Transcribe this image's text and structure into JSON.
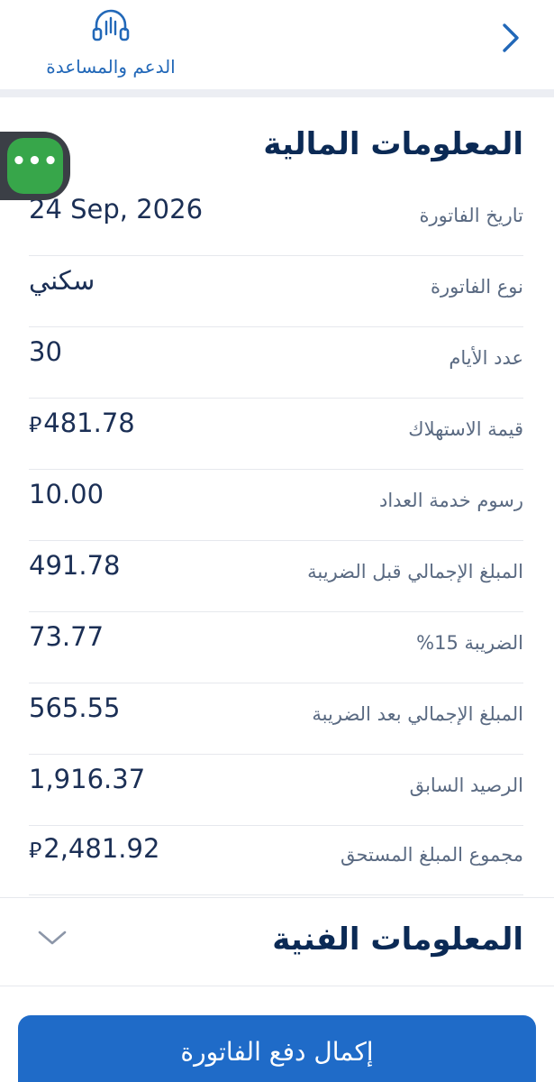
{
  "header": {
    "support_label": "الدعم والمساعدة"
  },
  "financial": {
    "title": "المعلومات المالية",
    "rows": [
      {
        "label": "تاريخ الفاتورة",
        "value": "24 Sep, 2026",
        "currency": ""
      },
      {
        "label": "نوع الفاتورة",
        "value": "سكني",
        "currency": ""
      },
      {
        "label": "عدد الأيام",
        "value": "30",
        "currency": ""
      },
      {
        "label": "قيمة الاستهلاك",
        "value": "481.78",
        "currency": "⃁"
      },
      {
        "label": "رسوم خدمة العداد",
        "value": "10.00",
        "currency": ""
      },
      {
        "label": "المبلغ الإجمالي قبل الضريبة",
        "value": "491.78",
        "currency": ""
      },
      {
        "label": "الضريبة 15%",
        "value": "73.77",
        "currency": ""
      },
      {
        "label": "المبلغ الإجمالي بعد الضريبة",
        "value": "565.55",
        "currency": ""
      },
      {
        "label": "الرصيد السابق",
        "value": "1,916.37",
        "currency": ""
      },
      {
        "label": "مجموع المبلغ المستحق",
        "value": "2,481.92",
        "currency": "⃁"
      }
    ]
  },
  "technical": {
    "title": "المعلومات الفنية"
  },
  "chat": {
    "glyph": "•••"
  },
  "actions": {
    "pay_label": "إكمال دفع الفاتورة"
  },
  "colors": {
    "primary": "#1f6bc8",
    "title": "#0b2a55",
    "label": "#5a6a82",
    "value": "#1b2f55",
    "chat": "#37a64a"
  }
}
